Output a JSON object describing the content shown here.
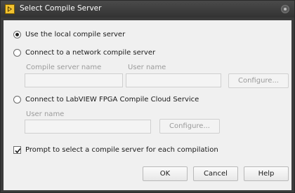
{
  "window": {
    "title": "Select Compile Server"
  },
  "options": {
    "local": {
      "label": "Use the local compile server",
      "checked": true
    },
    "network": {
      "label": "Connect to a network compile server",
      "checked": false
    },
    "cloud": {
      "label": "Connect to LabVIEW FPGA Compile Cloud Service",
      "checked": false
    }
  },
  "network_fields": {
    "server_name_label": "Compile server name",
    "server_name_value": "",
    "user_name_label": "User name",
    "user_name_value": "",
    "configure_label": "Configure..."
  },
  "cloud_fields": {
    "user_name_label": "User name",
    "user_name_value": "",
    "configure_label": "Configure..."
  },
  "prompt": {
    "label": "Prompt to select a compile server for each compilation",
    "checked": true
  },
  "buttons": {
    "ok": "OK",
    "cancel": "Cancel",
    "help": "Help"
  },
  "icons": {
    "app": "labview-icon",
    "close": "close-icon"
  }
}
